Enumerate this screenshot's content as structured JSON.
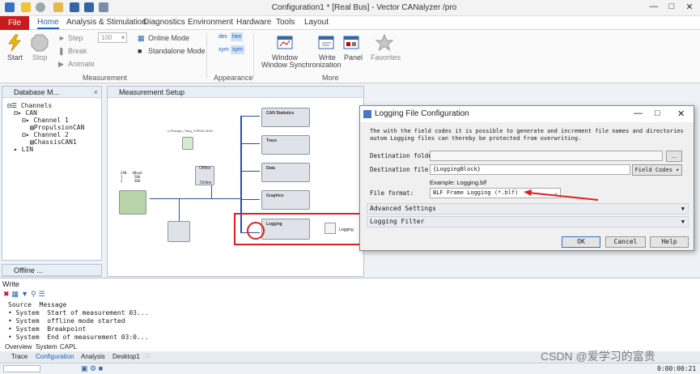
{
  "window": {
    "title": "Configuration1 * [Real Bus] - Vector CANalyzer /pro"
  },
  "tabs": [
    "File",
    "Home",
    "Analysis & Stimulation",
    "Diagnostics",
    "Environment",
    "Hardware",
    "Tools",
    "Layout"
  ],
  "ribbon": {
    "start": "Start",
    "stop": "Stop",
    "step": "Step",
    "break": "Break",
    "animate": "Animate",
    "speed_value": "100",
    "online_mode": "Online Mode",
    "standalone_mode": "Standalone Mode",
    "measurement_group": "Measurement",
    "dec": "dec",
    "hex": "hex",
    "sym": "sym",
    "sym2": "sym",
    "appearance_group": "Appearance",
    "window_sync": "Window Synchronization",
    "write": "Write",
    "panel": "Panel",
    "favorites": "Favorites",
    "more_group": "More"
  },
  "db_panel": {
    "title": "Database M...",
    "tree": [
      "Channels",
      "CAN",
      "Channel 1",
      "PropulsionCAN",
      "Channel 2",
      "ChassisCAN1",
      "LIN"
    ]
  },
  "offline_panel": {
    "title": "Offline ..."
  },
  "measurement": {
    "title": "Measurement Setup",
    "blocks": [
      "CAN Statistics",
      "Trace",
      "Data",
      "Graphics",
      "Logging"
    ],
    "logging_out": "Logging",
    "file_label": "e-Shengru_Tang_X2P001-NO6...",
    "online_label": "Online",
    "offline_label": "Offline",
    "can_table": "CAN   kBaud\n1      500\n2      500"
  },
  "dialog": {
    "title": "Logging File Configuration",
    "info": "The with the field codes it is possible to generate and increment file names and directories autom Logging files can thereby be protected from overwriting.",
    "dest_folder_label": "Destination folder:",
    "dest_file_label": "Destination file:",
    "dest_file_value": "{LoggingBlock}",
    "field_codes": "Field Codes",
    "example": "Example: Logging.blf",
    "file_format_label": "File format:",
    "file_format_value": "BLF Frame Logging (*.blf)",
    "advanced": "Advanced Settings",
    "filter": "Logging Filter",
    "ok": "OK",
    "cancel": "Cancel",
    "help": "Help",
    "browse": "..."
  },
  "write": {
    "title": "Write",
    "header": [
      "Source",
      "Message"
    ],
    "rows": [
      [
        "System",
        "Start of measurement 03..."
      ],
      [
        "System",
        "offline mode started"
      ],
      [
        "System",
        "Breakpoint"
      ],
      [
        "System",
        "End of measurement 03:0..."
      ]
    ],
    "subtabs": [
      "Overview",
      "System",
      "CAPL"
    ]
  },
  "bottom_tabs": [
    "Trace",
    "Configuration",
    "Analysis",
    "Desktop1"
  ],
  "status": {
    "time": "0:00:00:21"
  },
  "watermark": "CSDN @爱学习的富贵",
  "colors": {
    "accent": "#1f5fb5",
    "file_tab": "#c81b1b",
    "highlight": "#e02020"
  }
}
